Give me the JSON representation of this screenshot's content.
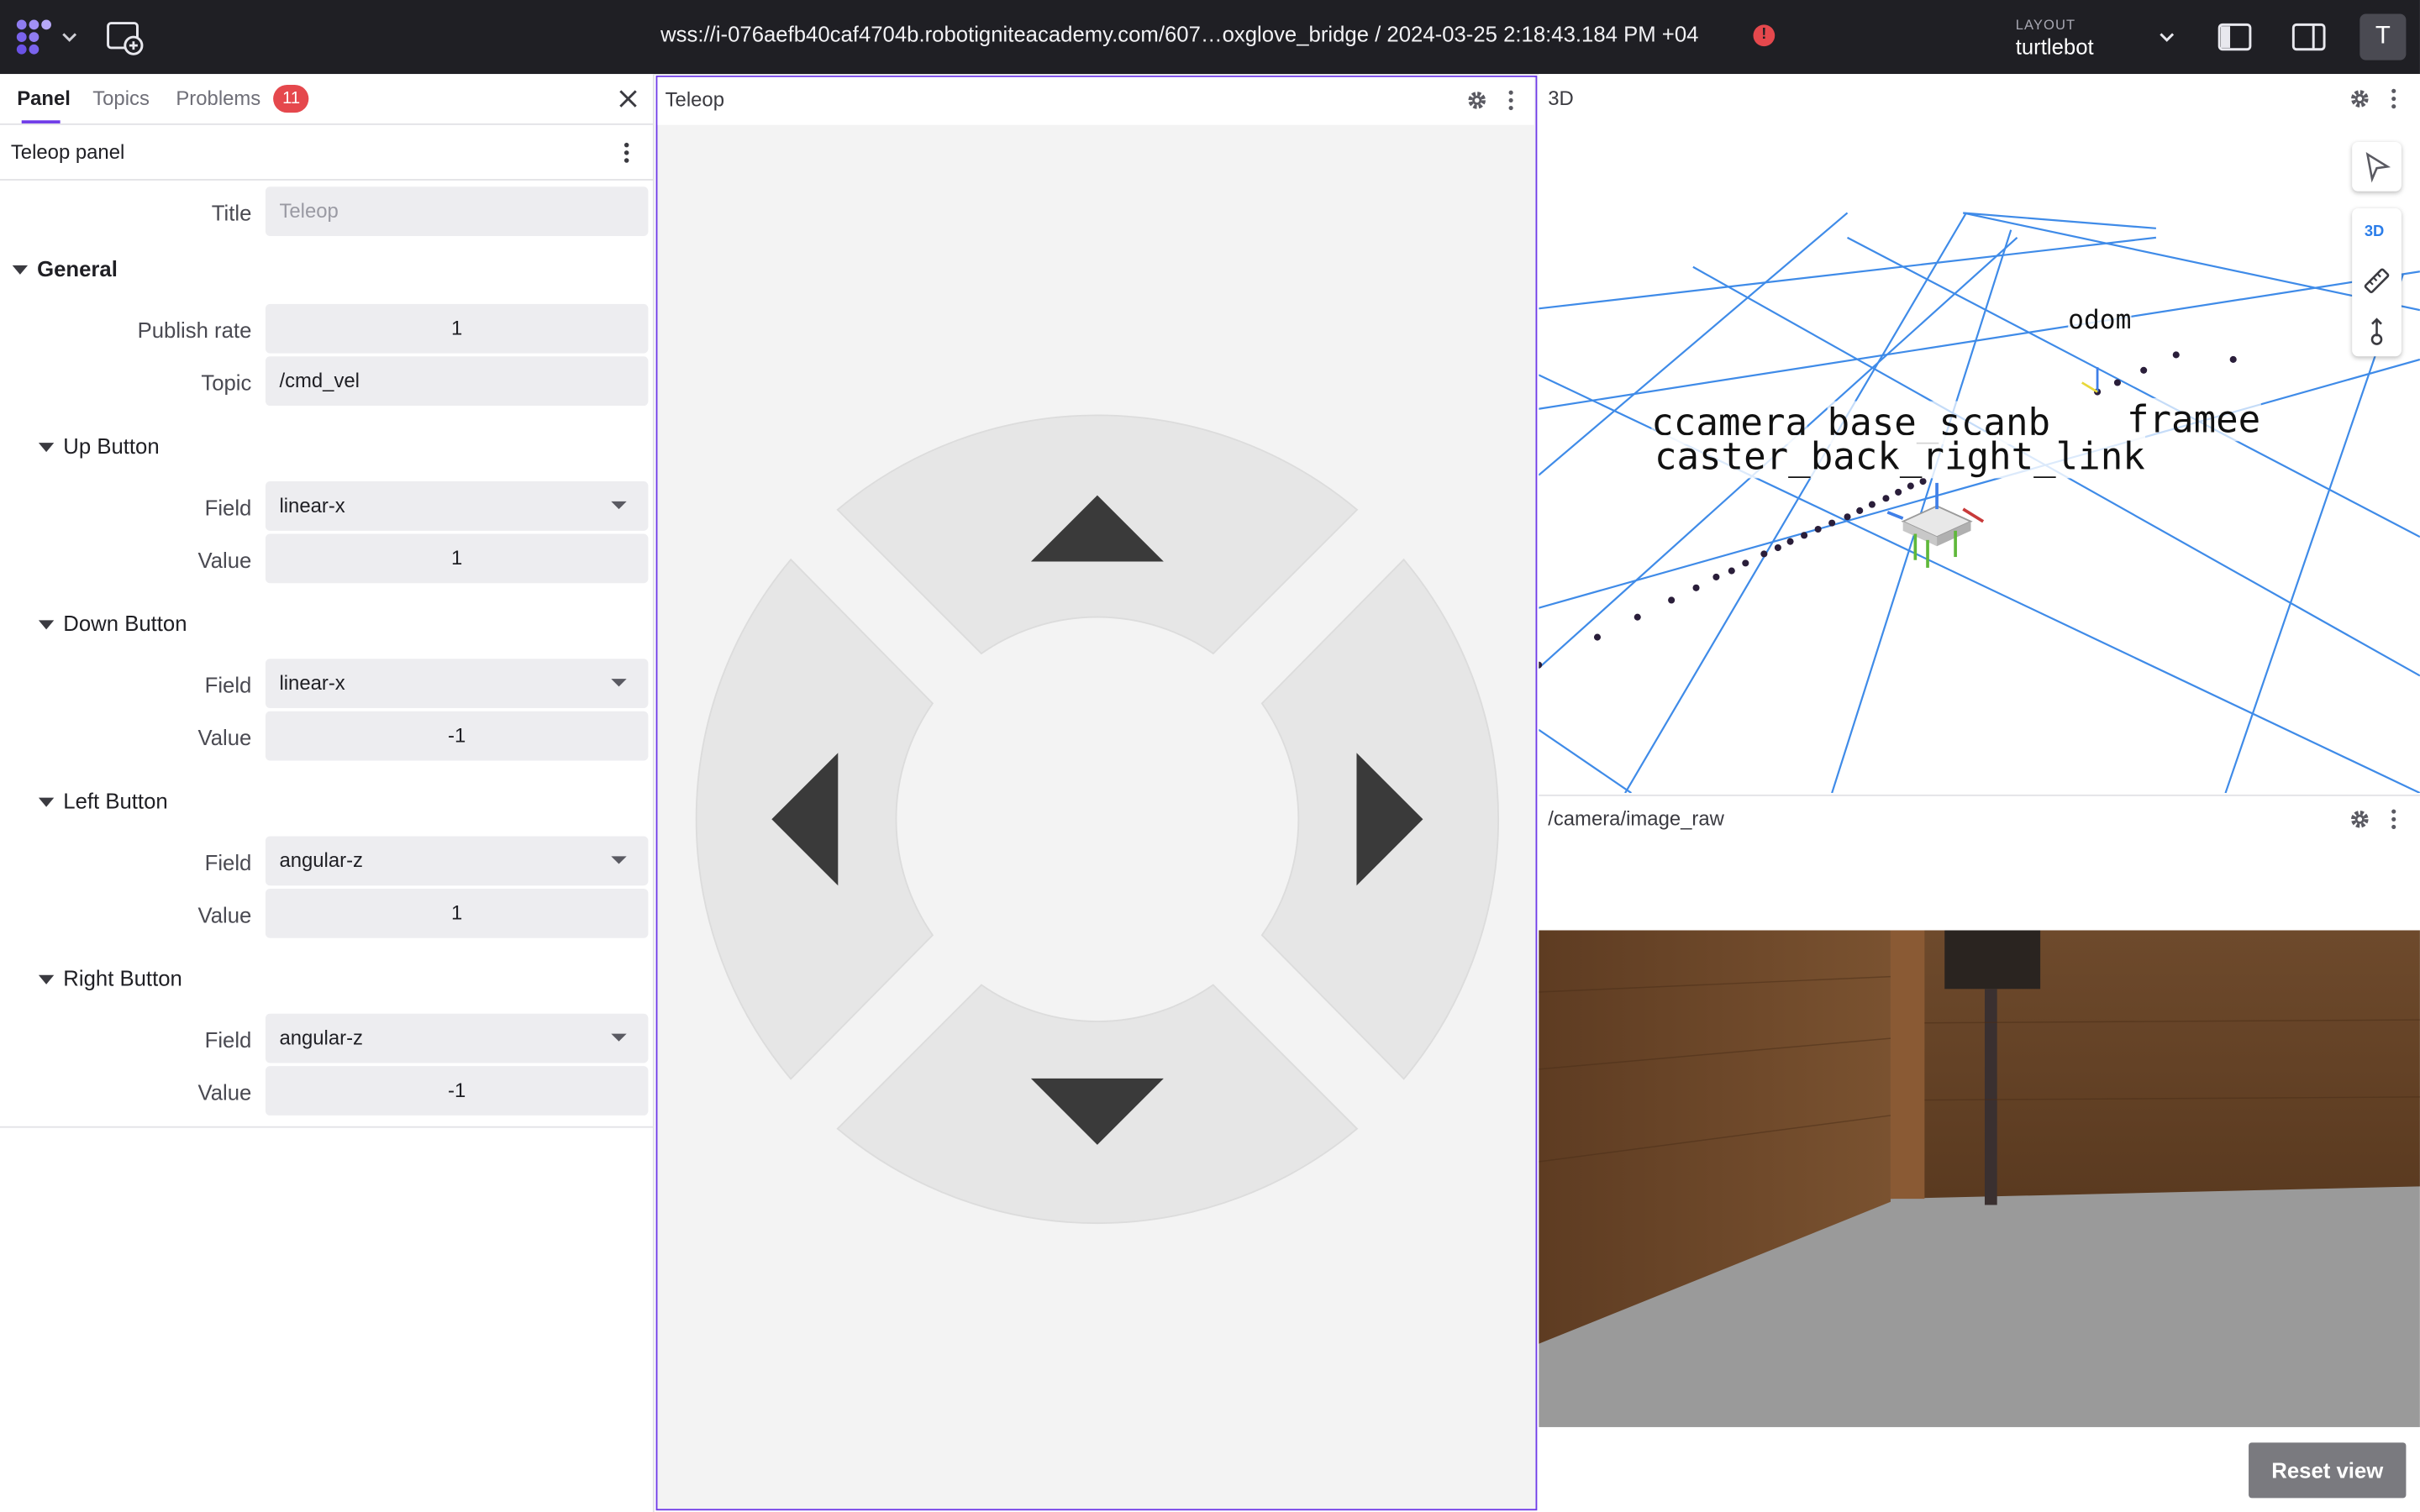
{
  "topbar": {
    "connection": "wss://i-076aefb40caf4704b.robotigniteacademy.com/607…oxglove_bridge / 2024-03-25 2:18:43.184 PM +04",
    "alert_glyph": "!",
    "layout_label": "LAYOUT",
    "layout_value": "turtlebot",
    "avatar_initial": "T"
  },
  "sidebar": {
    "tabs": [
      {
        "label": "Panel",
        "active": true
      },
      {
        "label": "Topics",
        "active": false
      },
      {
        "label": "Problems",
        "active": false
      }
    ],
    "problems_count": "11",
    "panel_title": "Teleop panel",
    "title_label": "Title",
    "title_placeholder": "Teleop",
    "general": {
      "label": "General",
      "publish_rate_label": "Publish rate",
      "publish_rate": "1",
      "topic_label": "Topic",
      "topic": "/cmd_vel"
    },
    "buttons": [
      {
        "section": "Up Button",
        "field_label": "Field",
        "field": "linear-x",
        "value_label": "Value",
        "value": "1"
      },
      {
        "section": "Down Button",
        "field_label": "Field",
        "field": "linear-x",
        "value_label": "Value",
        "value": "-1"
      },
      {
        "section": "Left Button",
        "field_label": "Field",
        "field": "angular-z",
        "value_label": "Value",
        "value": "1"
      },
      {
        "section": "Right Button",
        "field_label": "Field",
        "field": "angular-z",
        "value_label": "Value",
        "value": "-1"
      }
    ]
  },
  "teleop": {
    "title": "Teleop"
  },
  "scene3d": {
    "title": "3D",
    "mode_tag": "3D",
    "labels": {
      "odom": "odom",
      "camera": "ccamera",
      "base_scan": "base_scanb",
      "frame": "framee",
      "caster": "caster_back_right_link"
    },
    "colors": {
      "grid": "#3f8be8",
      "accent": "#6f3be8"
    }
  },
  "image_panel": {
    "title": "/camera/image_raw",
    "reset_label": "Reset view"
  }
}
